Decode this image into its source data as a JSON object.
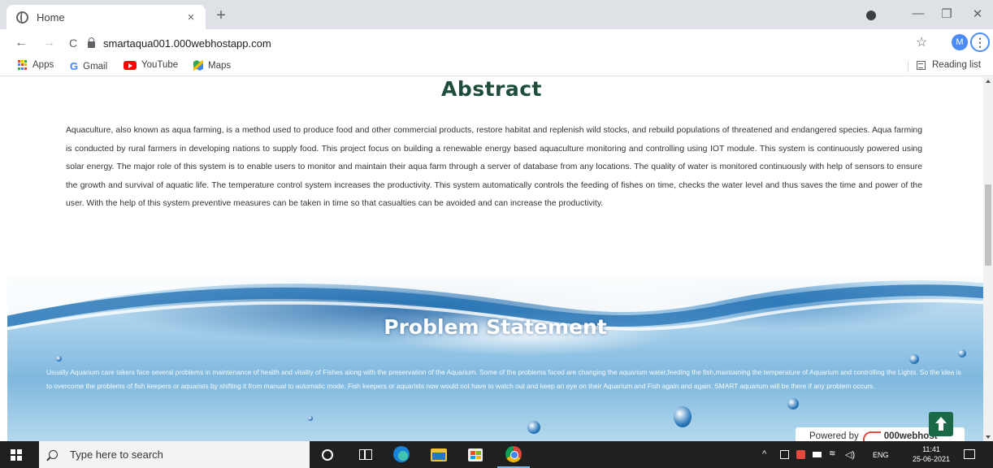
{
  "browser": {
    "tab_title": "Home",
    "tab_close": "×",
    "new_tab": "+",
    "url": "smartaqua001.000webhostapp.com",
    "profile_initial": "M",
    "menu_glyph": "⋮",
    "bookmarks": [
      {
        "label": "Apps",
        "icon": "apps-grid-icon"
      },
      {
        "label": "Gmail",
        "icon": "gmail-icon"
      },
      {
        "label": "YouTube",
        "icon": "youtube-icon"
      },
      {
        "label": "Maps",
        "icon": "maps-icon"
      }
    ],
    "reading_list": "Reading list",
    "nav": {
      "back": "←",
      "forward": "→",
      "reload": "C"
    },
    "window": {
      "minimize": "—",
      "restore": "❐",
      "close": "✕"
    },
    "star": "☆"
  },
  "page": {
    "abstract_title": "Abstract",
    "abstract_text": "Aquaculture, also known as aqua farming, is a method used to produce food and other commercial products, restore habitat and replenish wild stocks, and rebuild populations of threatened and endangered species. Aqua farming is conducted by rural farmers in developing nations to supply food. This project focus on building a renewable energy based aquaculture monitoring and controlling using IOT module. This system is continuously powered using solar energy. The major role of this system is to enable users to monitor and maintain their aqua farm through a server of database from any locations. The quality of water is monitored continuously with help of sensors to ensure the growth and survival of aquatic life. The temperature control system increases the productivity. This system automatically controls the feeding of fishes on time, checks the water level and thus saves the time and power of the user. With the help of this system preventive measures can be taken in time so that casualties can be avoided and can increase the productivity.",
    "problem_title": "Problem Statement",
    "problem_text": "Usually Aquarium care takers face several problems in maintenance of health and vitality of Fishes along with the preservation of the Aquarium. Some of the problems faced are changing the aquarium water,feeding the fish,maintaining the temperature of Aquarium and controlling the Lights. So the idea is to overcome the problems of fish keepers or aquarists by shifting it from manual to automatic mode. Fish keepers or aquarists now would not have to watch out and keep an eye on their Aquarium and Fish again and again. SMART aquarium will be there if any problem occurs.",
    "powered_by": "Powered by",
    "powered_brand": "000webhost"
  },
  "taskbar": {
    "search_placeholder": "Type here to search",
    "language": "ENG",
    "time": "11:41",
    "date": "25-06-2021",
    "pinned": [
      "cortana-icon",
      "task-view-icon",
      "edge-icon",
      "file-explorer-icon",
      "store-icon",
      "chrome-icon"
    ]
  },
  "colors": {
    "abstract_title": "#1e4d3a",
    "back_to_top": "#1a6a48",
    "taskbar": "#202020",
    "chrome_accent": "#4c8bf5"
  }
}
